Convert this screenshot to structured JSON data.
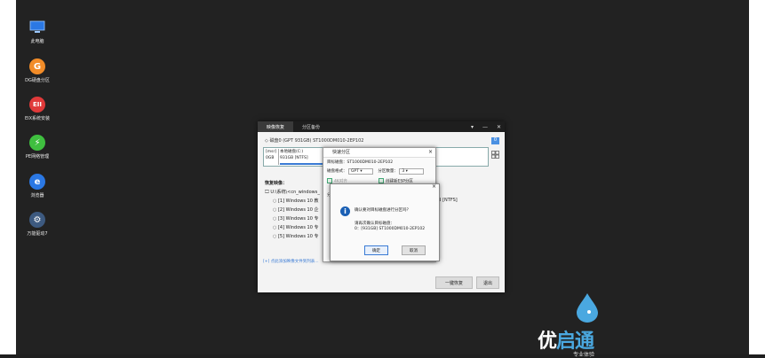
{
  "desktop": {
    "icons": [
      {
        "label": "此电脑",
        "icon": "computer-icon",
        "color": "#2b78e4"
      },
      {
        "label": "DG硬盘分区",
        "icon": "diskgenius-icon",
        "color": "#f28c28",
        "glyph": "G"
      },
      {
        "label": "EIX系统安装",
        "icon": "eix-icon",
        "color": "#e03a3a",
        "glyph": "EII"
      },
      {
        "label": "PE网络管理",
        "icon": "network-icon",
        "color": "#3fbf3f",
        "glyph": "⚡"
      },
      {
        "label": "浏览器",
        "icon": "browser-icon",
        "color": "#2b78e4",
        "glyph": "e"
      },
      {
        "label": "万能驱动7",
        "icon": "gear-icon",
        "color": "#3d5a80",
        "glyph": "⚙"
      }
    ]
  },
  "main_window": {
    "tabs": [
      "映像恢复",
      "分区备份"
    ],
    "controls": [
      "▾",
      "—",
      "✕"
    ],
    "disk_line": "磁盘0 (GPT 931GB) ST1000DM010-2EP102",
    "badge": "0",
    "partitions": {
      "p1": [
        "[msr]",
        "0GB"
      ],
      "p2": [
        "本地磁盘(C:)",
        "931GB [NTFS]"
      ]
    },
    "recover_label": "恢复映像：",
    "tree_root": "U:\\系统\\<cn_windows_",
    "tree_items": [
      "[1] Windows 10 教",
      "[2] Windows 10 企",
      "[3] Windows 10 专",
      "[4] Windows 10 专",
      "[5] Windows 10 专"
    ],
    "right_info": "1GB [NTFS]",
    "add_link": "[+] 点此添加映像文件到列表...",
    "buttons": {
      "restore": "一键恢复",
      "exit": "退出"
    }
  },
  "quick_dialog": {
    "title": "快速分区",
    "target_label": "目标磁盘：",
    "target_value": "ST1000DM010-2EP102",
    "format_label": "磁盘格式：",
    "format_value": "GPT",
    "count_label": "分区数量：",
    "count_value": "3",
    "opt1": "4K对齐",
    "opt2": "创建新ESP分区",
    "extra_label": "分"
  },
  "confirm_dialog": {
    "question": "确认要对目标磁盘进行分区吗？",
    "line1": "请再次确认目标磁盘：",
    "line2": "0：[931GB] ST1000DM010-2EP102",
    "ok": "确定",
    "cancel": "取消"
  },
  "logo": {
    "brand_a": "优",
    "brand_b": "启通",
    "sub": "专业体验"
  }
}
